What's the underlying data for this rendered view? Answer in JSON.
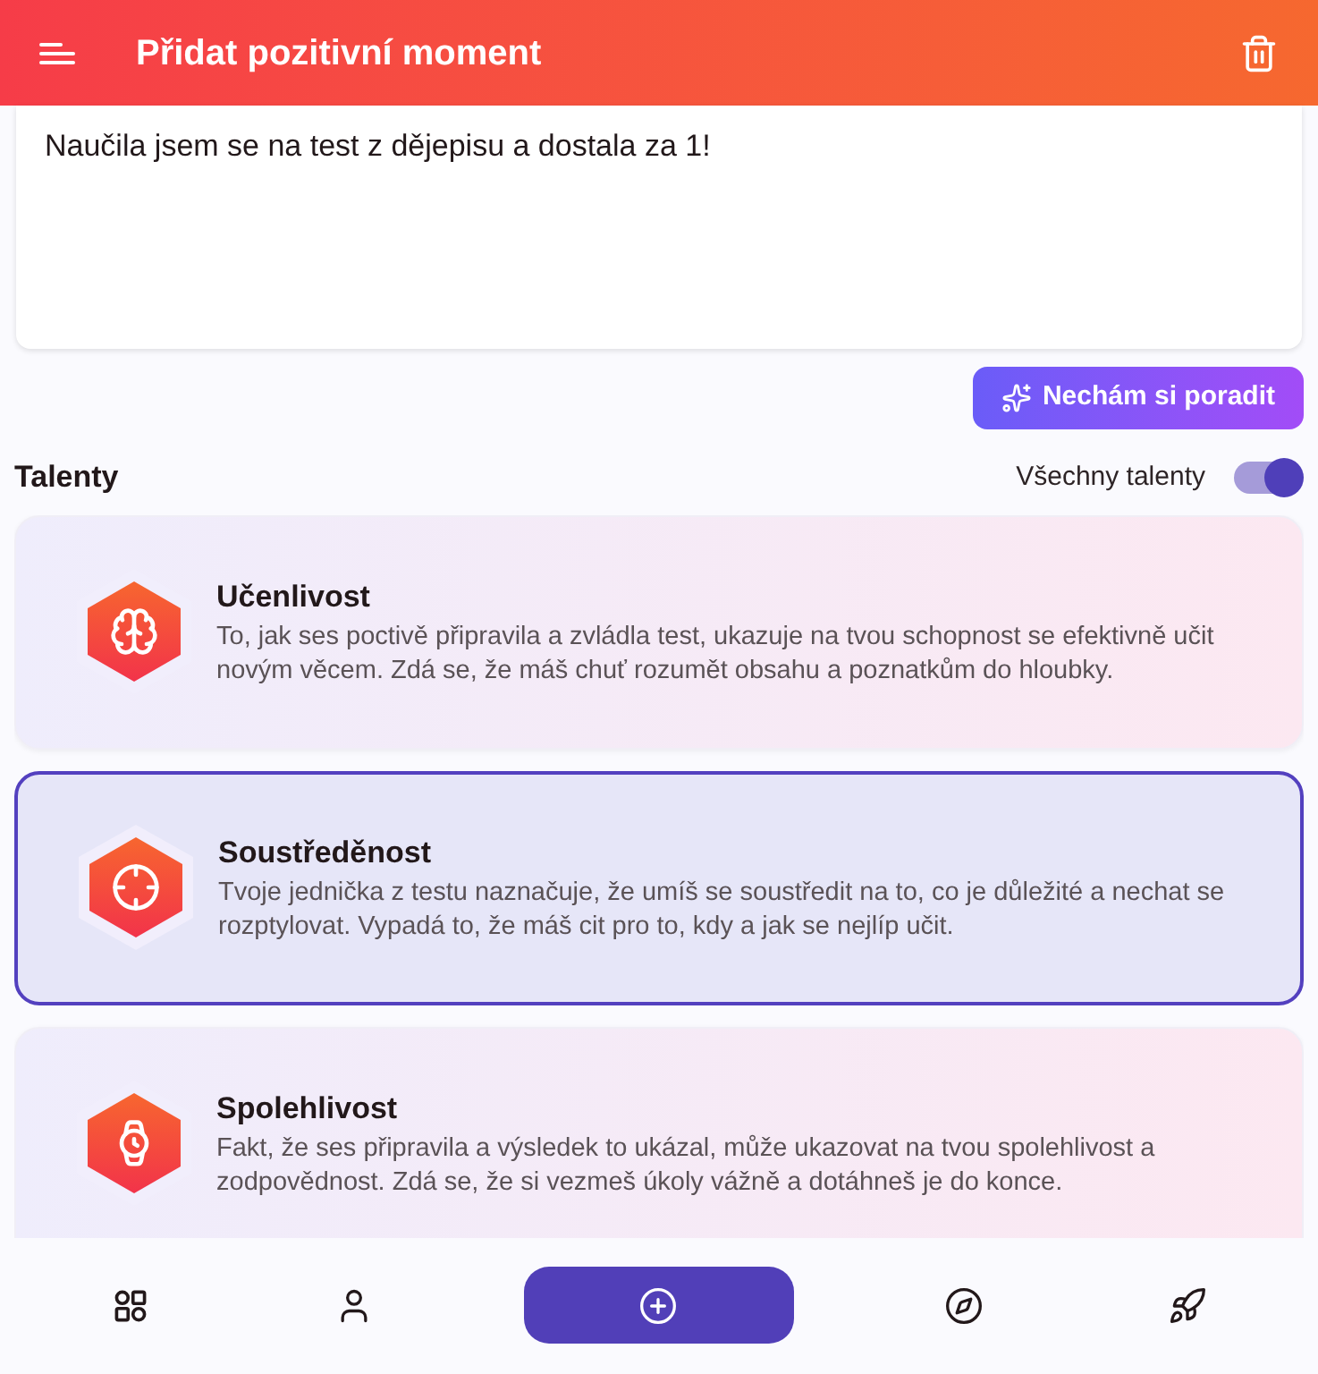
{
  "header": {
    "title": "Přidat pozitivní moment"
  },
  "moment": {
    "value": "Naučila jsem se na test z dějepisu a dostala za 1!"
  },
  "advice_button": "Nechám si poradit",
  "talents_section": {
    "title": "Talenty",
    "toggle": {
      "label": "Všechny talenty",
      "on": true
    }
  },
  "talents": [
    {
      "title": "Učenlivost",
      "text": "To, jak ses poctivě připravila a zvládla test, ukazuje na tvou schopnost se efektivně učit novým věcem. Zdá se, že máš chuť rozumět obsahu a poznatkům do hloubky.",
      "selected": false
    },
    {
      "title": "Soustředěnost",
      "text": "Tvoje jednička z testu naznačuje, že umíš se soustředit na to, co je důležité a nechat se rozptylovat. Vypadá to, že máš cit pro to, kdy a jak se nejlíp učit.",
      "selected": true
    },
    {
      "title": "Spolehlivost",
      "text": "Fakt, že ses připravila a výsledek to ukázal, může ukazovat na tvou spolehlivost a zodpovědnost. Zdá se, že si vezmeš úkoly vážně a dotáhneš je do konce.",
      "selected": false
    }
  ],
  "nav": [
    {
      "selected": false
    },
    {
      "selected": false
    },
    {
      "selected": true
    },
    {
      "selected": false
    },
    {
      "selected": false
    }
  ]
}
